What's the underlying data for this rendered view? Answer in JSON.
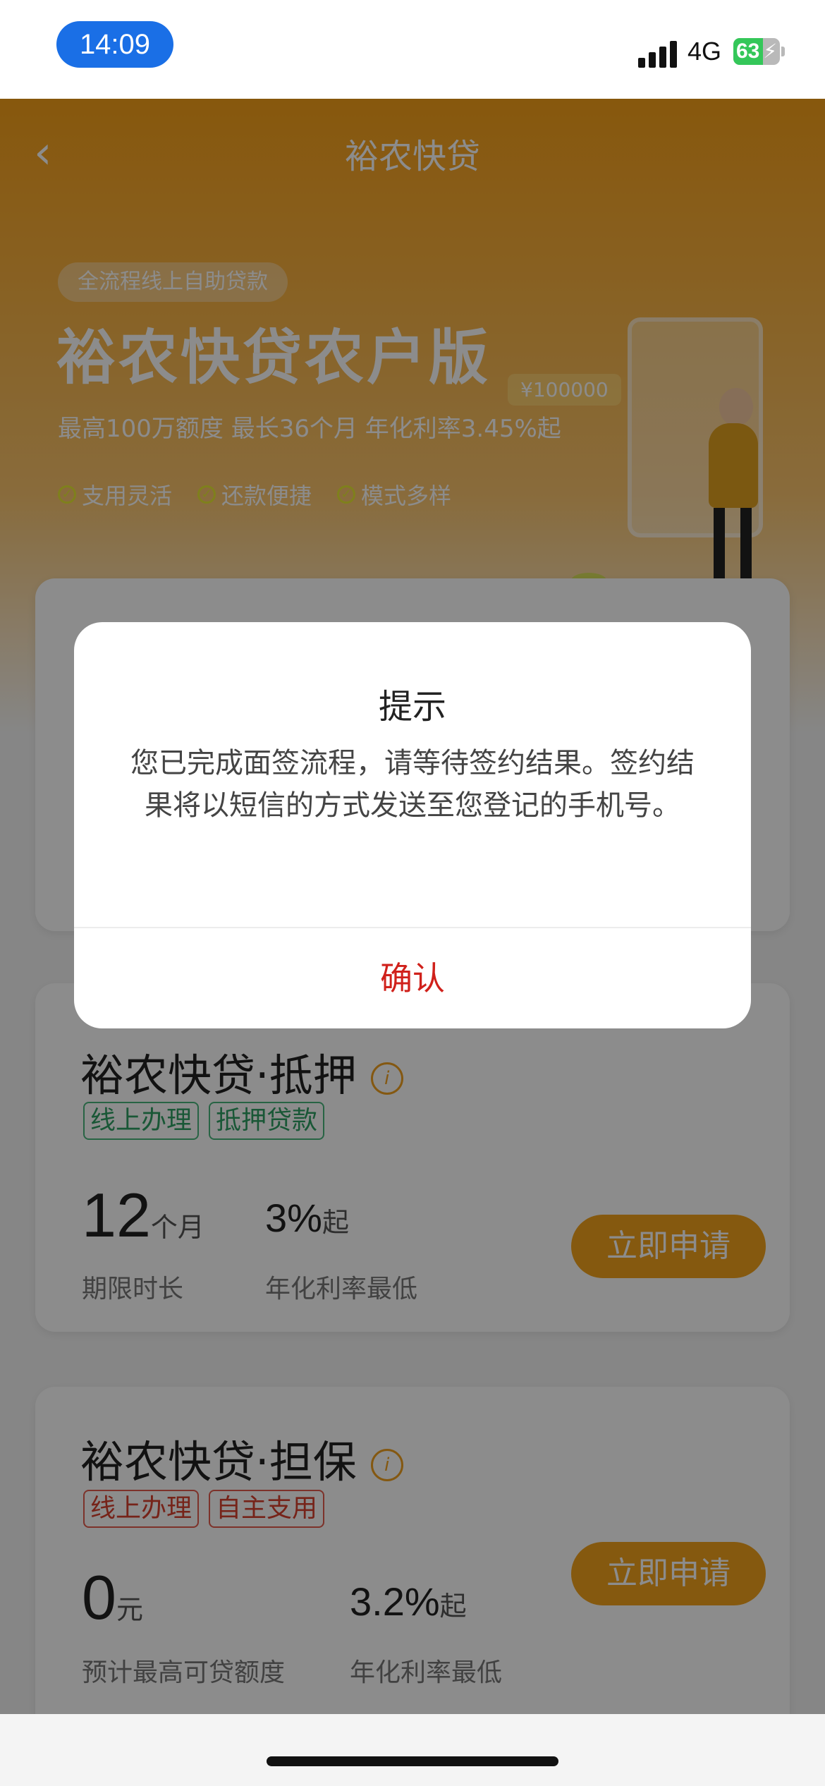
{
  "status_bar": {
    "time": "14:09",
    "network": "4G",
    "battery_level": "63",
    "battery_fraction": 0.63
  },
  "nav": {
    "title": "裕农快贷"
  },
  "hero": {
    "badge": "全流程线上自助贷款",
    "title": "裕农快贷农户版",
    "subtitle": "最高100万额度 最长36个月 年化利率3.45%起",
    "tags": [
      "支用灵活",
      "还款便捷",
      "模式多样"
    ],
    "illustration_amount": "¥100000"
  },
  "cards": [
    {
      "title": "裕农快贷·抵押",
      "tags": [
        "线上办理",
        "抵押贷款"
      ],
      "stat1_value": "12",
      "stat1_unit": "个月",
      "stat1_label": "期限时长",
      "stat2_value": "3%",
      "stat2_unit": "起",
      "stat2_label": "年化利率最低",
      "button": "立即申请"
    },
    {
      "title": "裕农快贷·担保",
      "tags": [
        "线上办理",
        "自主支用"
      ],
      "stat1_value": "0",
      "stat1_unit": "元",
      "stat1_label": "预计最高可贷额度",
      "stat2_value": "3.2%",
      "stat2_unit": "起",
      "stat2_label": "年化利率最低",
      "button": "立即申请"
    }
  ],
  "dialog": {
    "title": "提示",
    "message": "您已完成面签流程，请等待签约结果。签约结果将以短信的方式发送至您登记的手机号。",
    "confirm": "确认"
  },
  "colors": {
    "primary_orange": "#f2a21c",
    "confirm_red": "#d0211b",
    "status_pill_blue": "#1a6fe6"
  }
}
